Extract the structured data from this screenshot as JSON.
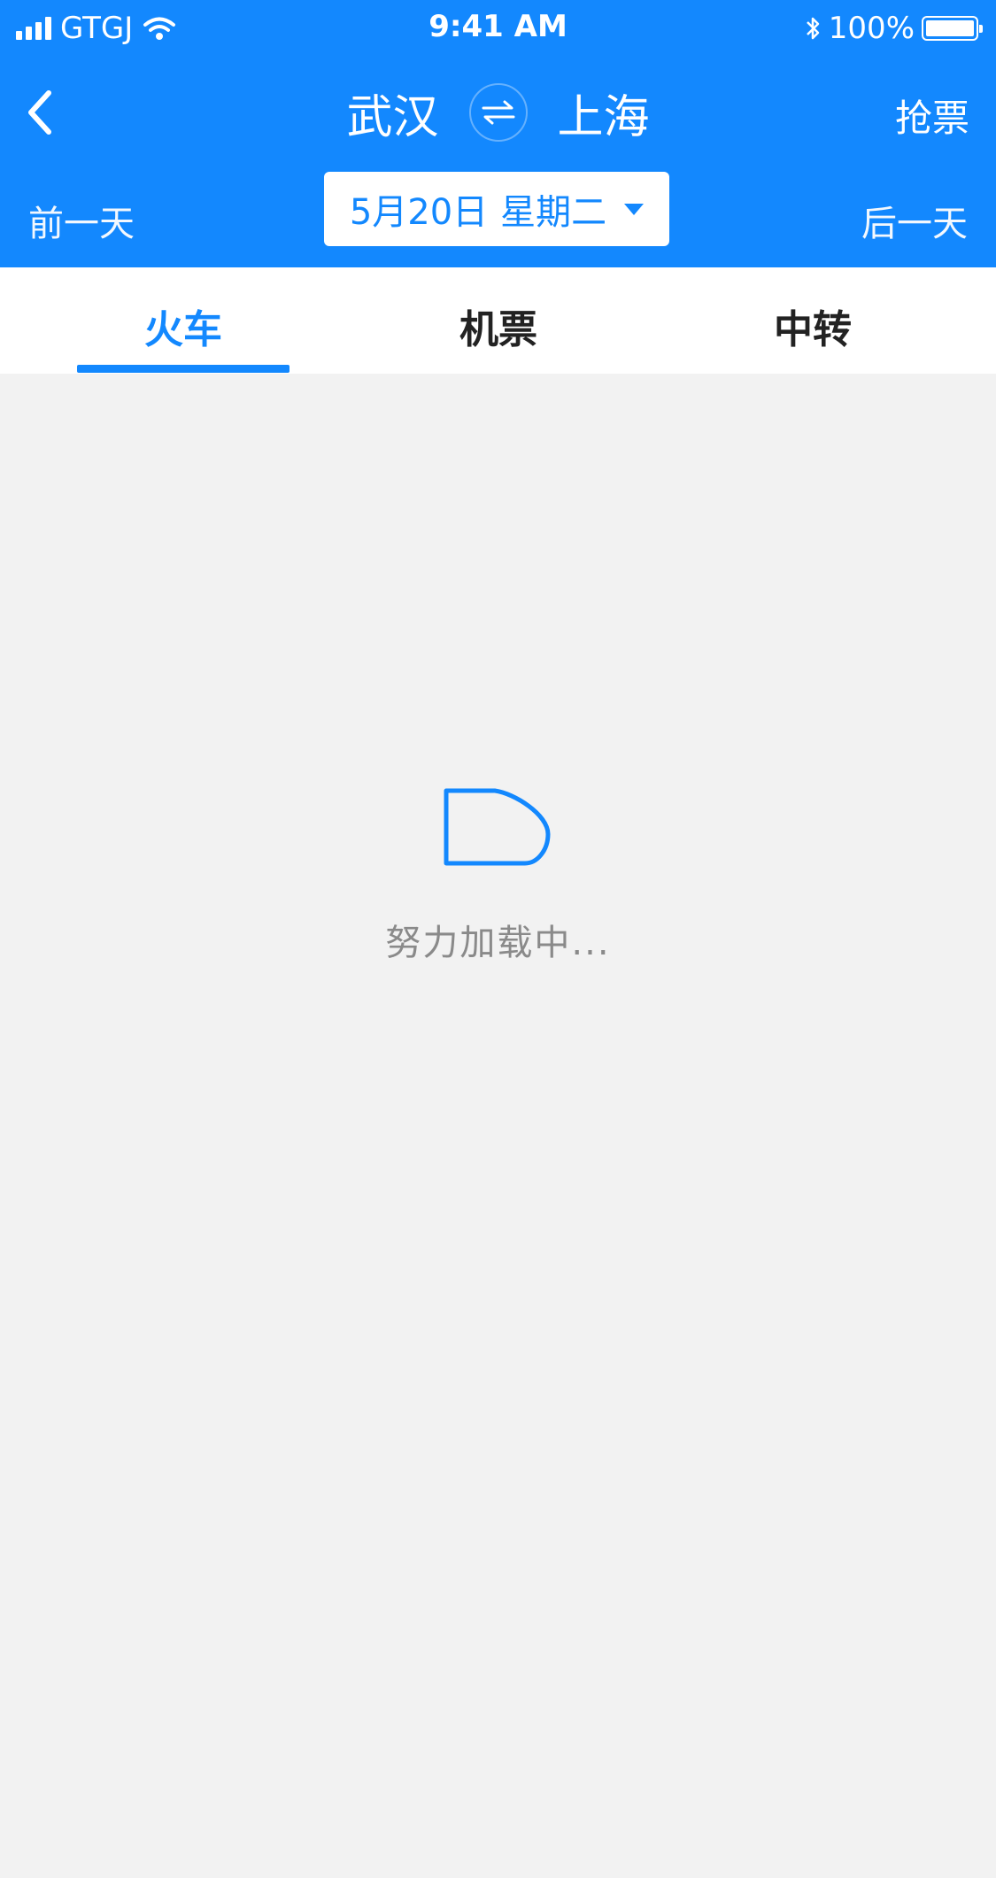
{
  "status_bar": {
    "carrier": "GTGJ",
    "time": "9:41 AM",
    "battery": "100%"
  },
  "header": {
    "from_city": "武汉",
    "to_city": "上海",
    "grab_ticket": "抢票"
  },
  "date_bar": {
    "prev_day": "前一天",
    "date": "5月20日",
    "weekday": "星期二",
    "next_day": "后一天"
  },
  "tabs": [
    {
      "label": "火车",
      "active": true
    },
    {
      "label": "机票",
      "active": false
    },
    {
      "label": "中转",
      "active": false
    }
  ],
  "loading": {
    "text": "努力加载中..."
  },
  "colors": {
    "accent": "#1388fe",
    "background": "#f2f2f2"
  }
}
